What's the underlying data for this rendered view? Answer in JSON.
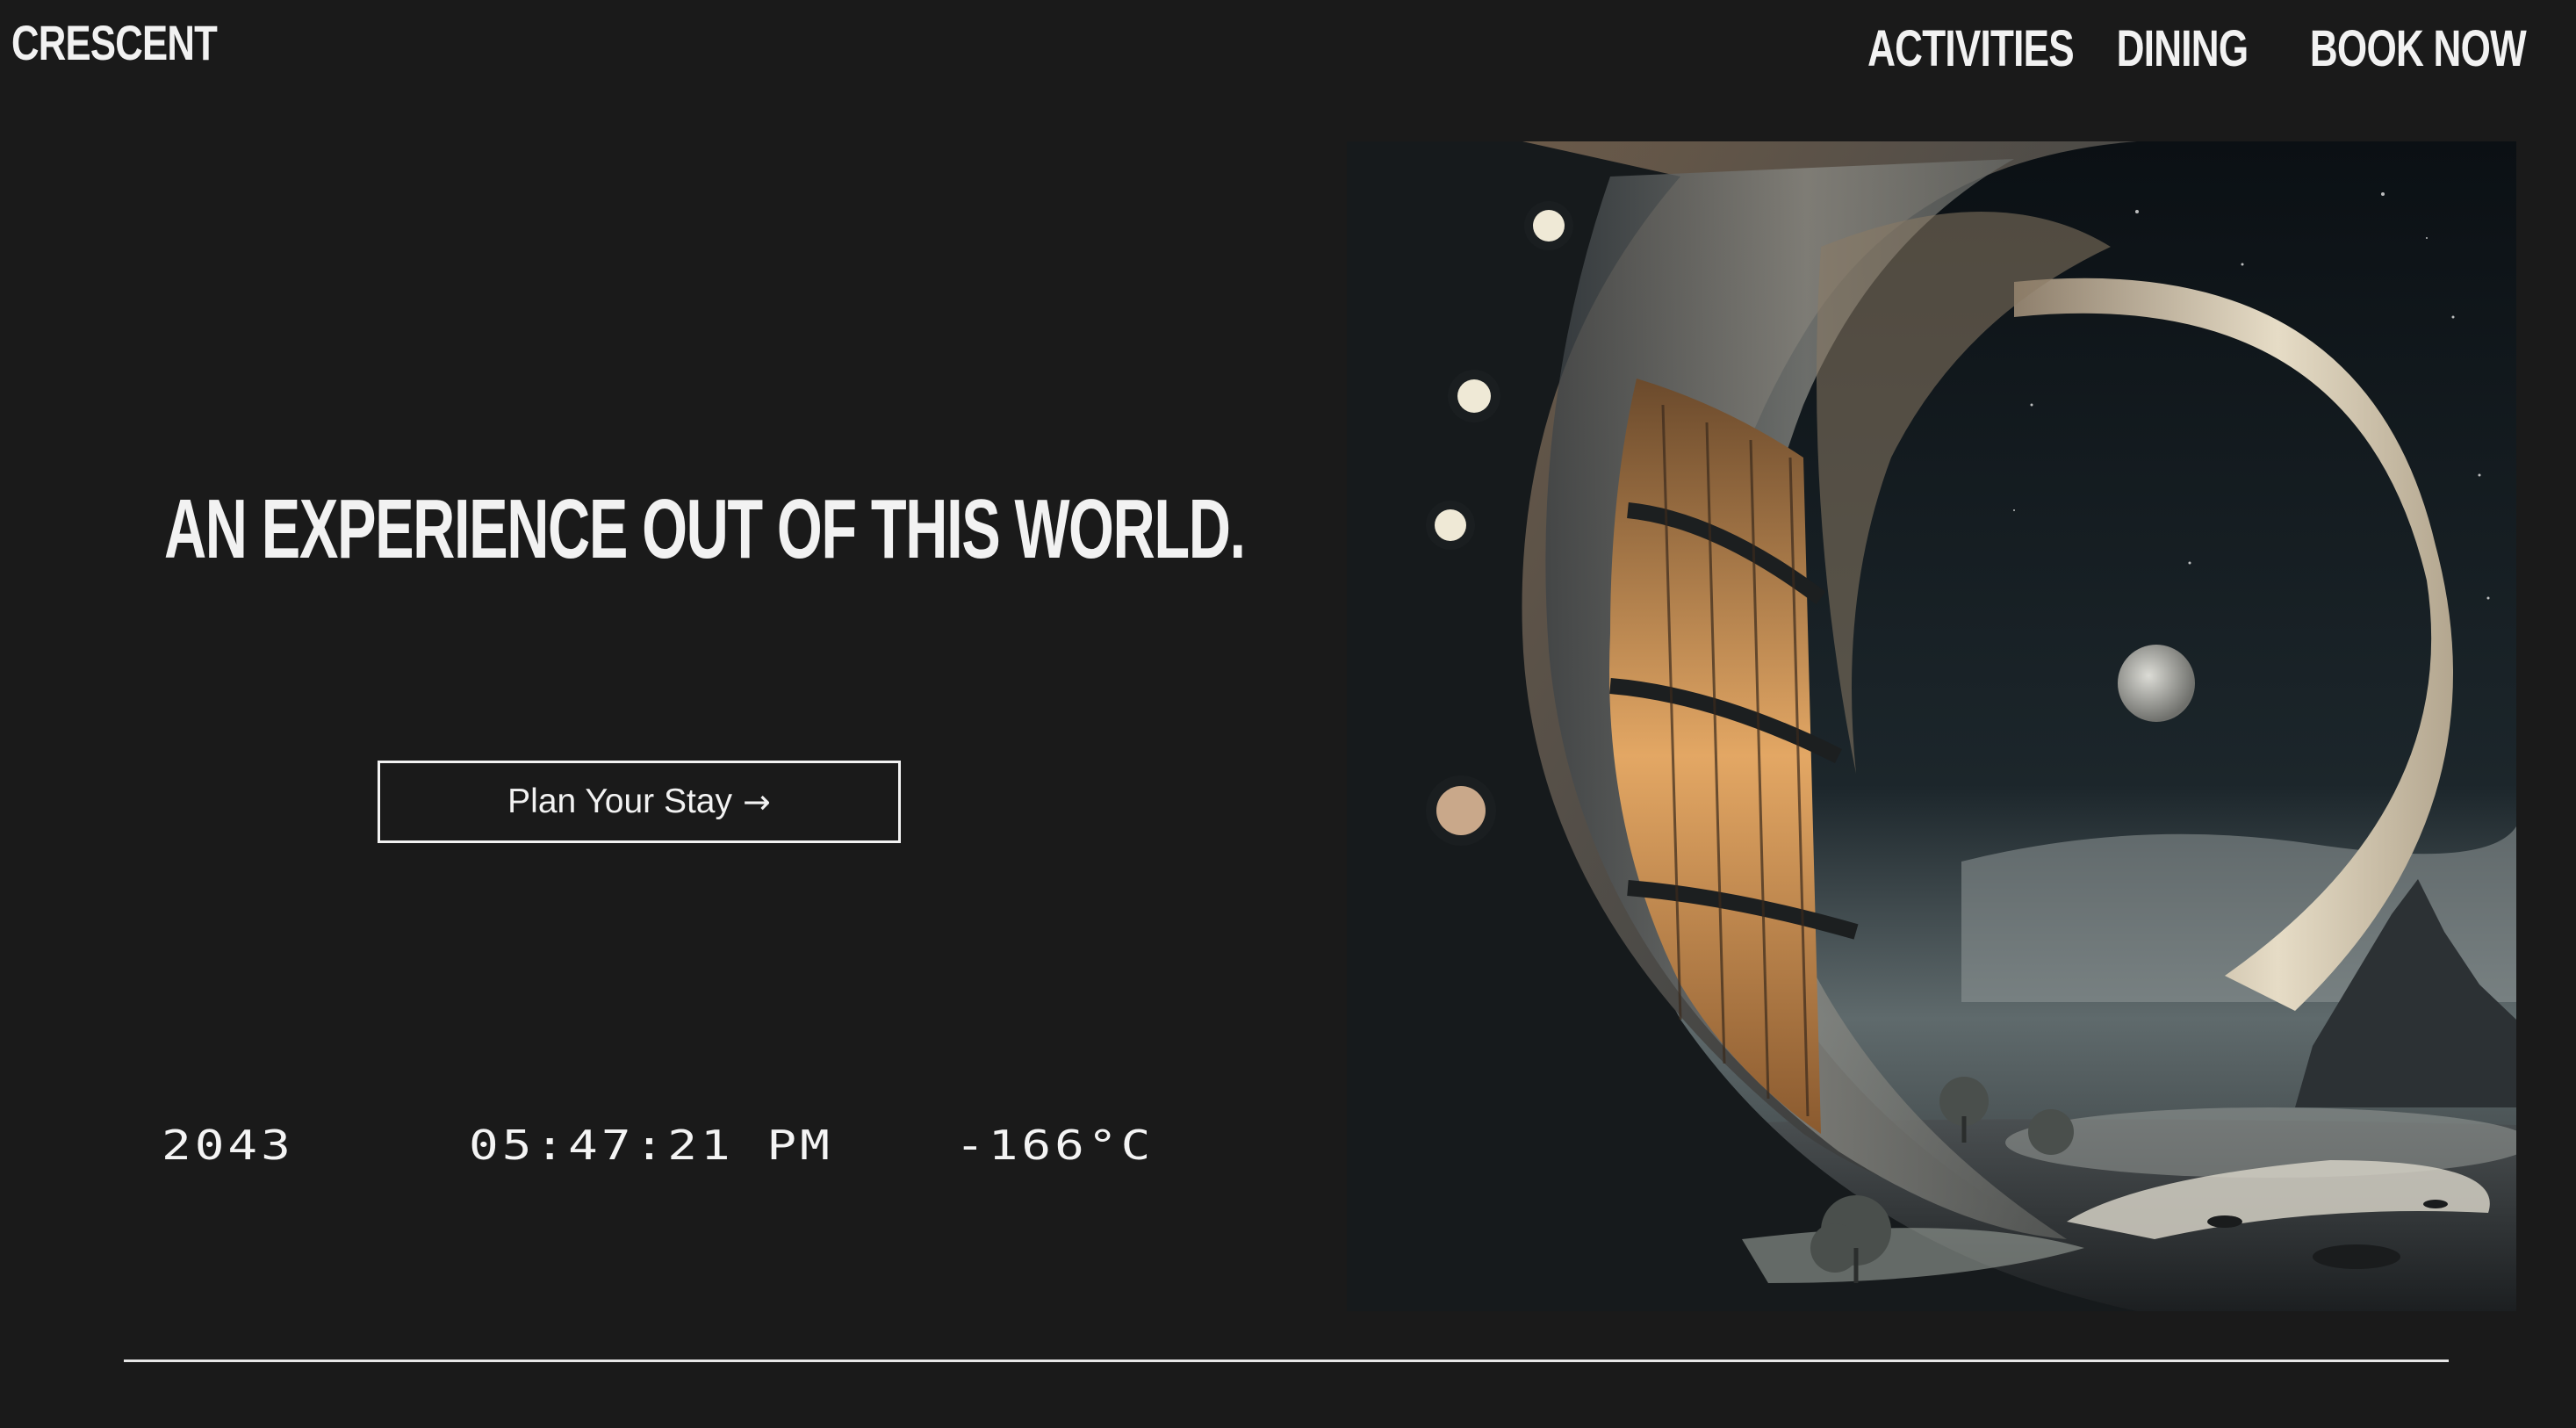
{
  "header": {
    "logo": "CRESCENT",
    "nav": [
      {
        "label": "ACTIVITIES"
      },
      {
        "label": "DINING"
      },
      {
        "label": "BOOK NOW"
      }
    ]
  },
  "hero": {
    "headline": "AN EXPERIENCE OUT OF THIS WORLD.",
    "cta": {
      "label": "Plan Your Stay",
      "icon": "arrow-right-icon"
    },
    "image": {
      "subject": "crescent-shaped lunar hotel illustration"
    }
  },
  "stats": {
    "year": "2043",
    "time": "05:47:21 PM",
    "temperature": "-166°C"
  },
  "colors": {
    "background": "#1a1a1a",
    "text": "#f2f2f2",
    "divider": "#e6e6e6"
  }
}
